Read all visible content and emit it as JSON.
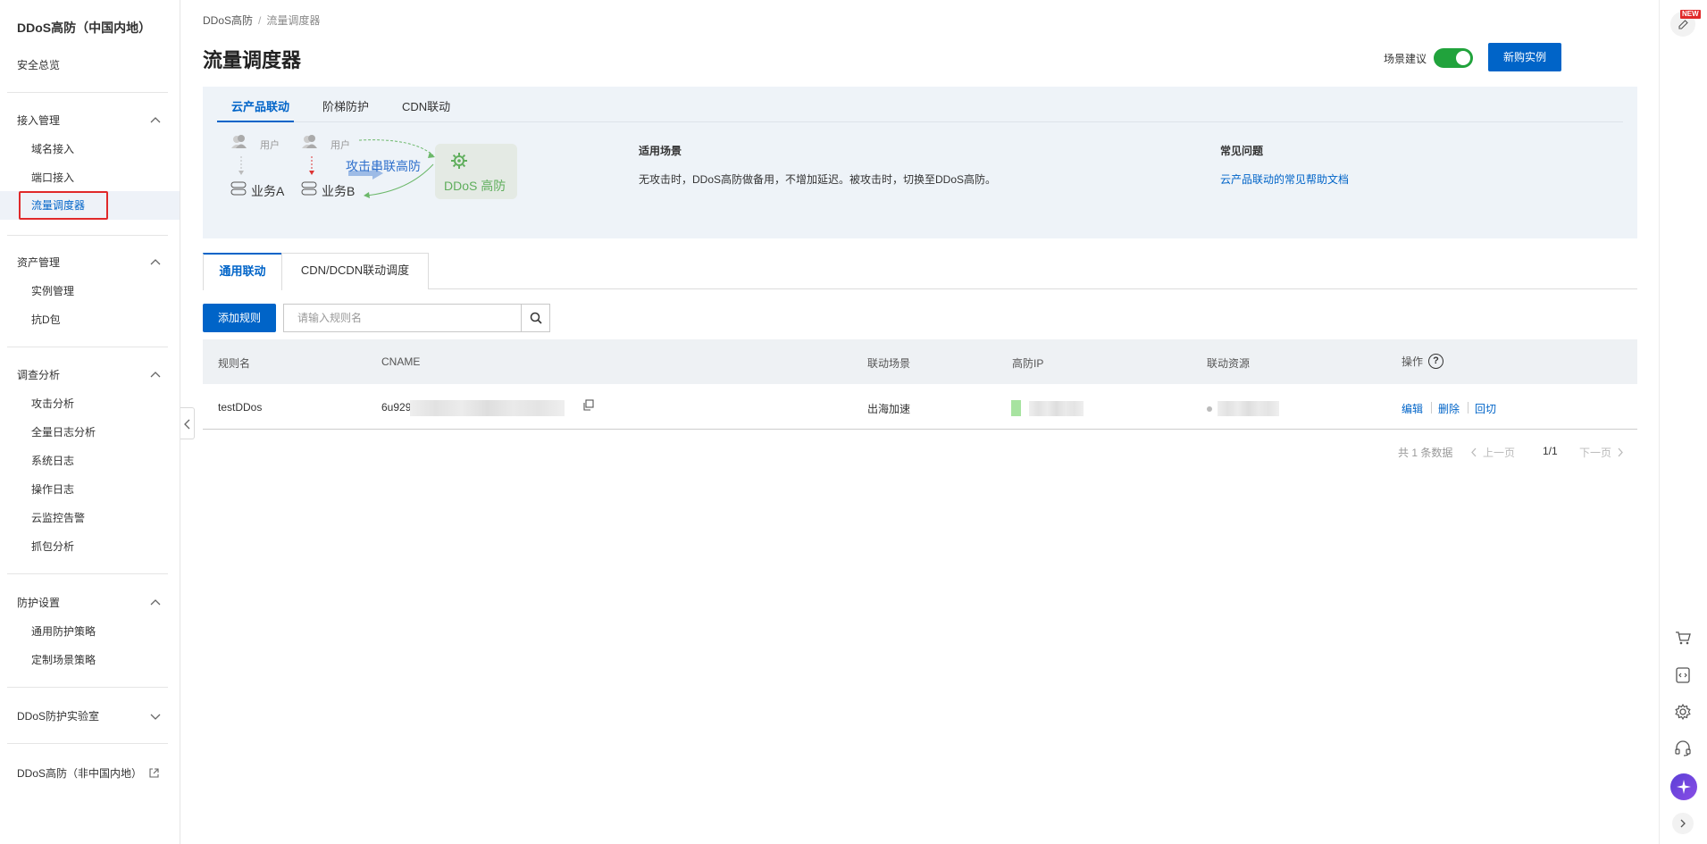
{
  "sidebar": {
    "title": "DDoS高防（中国内地）",
    "overview": "安全总览",
    "groups": [
      {
        "label": "接入管理",
        "items": [
          "域名接入",
          "端口接入",
          "流量调度器"
        ]
      },
      {
        "label": "资产管理",
        "items": [
          "实例管理",
          "抗D包"
        ]
      },
      {
        "label": "调查分析",
        "items": [
          "攻击分析",
          "全量日志分析",
          "系统日志",
          "操作日志",
          "云监控告警",
          "抓包分析"
        ]
      },
      {
        "label": "防护设置",
        "items": [
          "通用防护策略",
          "定制场景策略"
        ]
      },
      {
        "label": "DDoS防护实验室",
        "items": []
      }
    ],
    "external_link": "DDoS高防（非中国内地）",
    "active_item": "流量调度器"
  },
  "breadcrumb": {
    "root": "DDoS高防",
    "separator": "/",
    "current": "流量调度器"
  },
  "page_title": "流量调度器",
  "scene_suggestion": {
    "label": "场景建议",
    "enabled": true
  },
  "buy_button": "新购实例",
  "info_panel": {
    "tabs": [
      "云产品联动",
      "阶梯防护",
      "CDN联动"
    ],
    "active_tab": "云产品联动",
    "diagram": {
      "user_label": "用户",
      "business_a": "业务A",
      "business_b": "业务B",
      "attack_text": "攻击串联高防",
      "ddos_label": "DDoS 高防"
    },
    "scenario_title": "适用场景",
    "scenario_text": "无攻击时，DDoS高防做备用，不增加延迟。被攻击时，切换至DDoS高防。",
    "faq_title": "常见问题",
    "faq_link": "云产品联动的常见帮助文档"
  },
  "sub_tabs": [
    "通用联动",
    "CDN/DCDN联动调度"
  ],
  "active_sub_tab": "通用联动",
  "toolbar": {
    "add_button": "添加规则",
    "search_placeholder": "请输入规则名",
    "search_value": ""
  },
  "table": {
    "columns": [
      "规则名",
      "CNAME",
      "联动场景",
      "高防IP",
      "联动资源",
      "操作"
    ],
    "rows": [
      {
        "rule_name": "testDDos",
        "cname": "6u929",
        "scene": "出海加速",
        "actions": [
          "编辑",
          "删除",
          "回切"
        ]
      }
    ]
  },
  "pagination": {
    "total": "共 1 条数据",
    "prev": "上一页",
    "page": "1/1",
    "next": "下一页"
  },
  "right_toolbar": {
    "badge": "NEW",
    "icons": [
      "edit-icon",
      "cart-icon",
      "code-icon",
      "gear-icon",
      "headset-icon",
      "ai-assistant-icon",
      "chevron-right-icon"
    ]
  },
  "colors": {
    "primary": "#0064c8",
    "toggle_on": "#21a33c",
    "highlight": "#e0292a",
    "ddos_green": "#5fae5c"
  }
}
